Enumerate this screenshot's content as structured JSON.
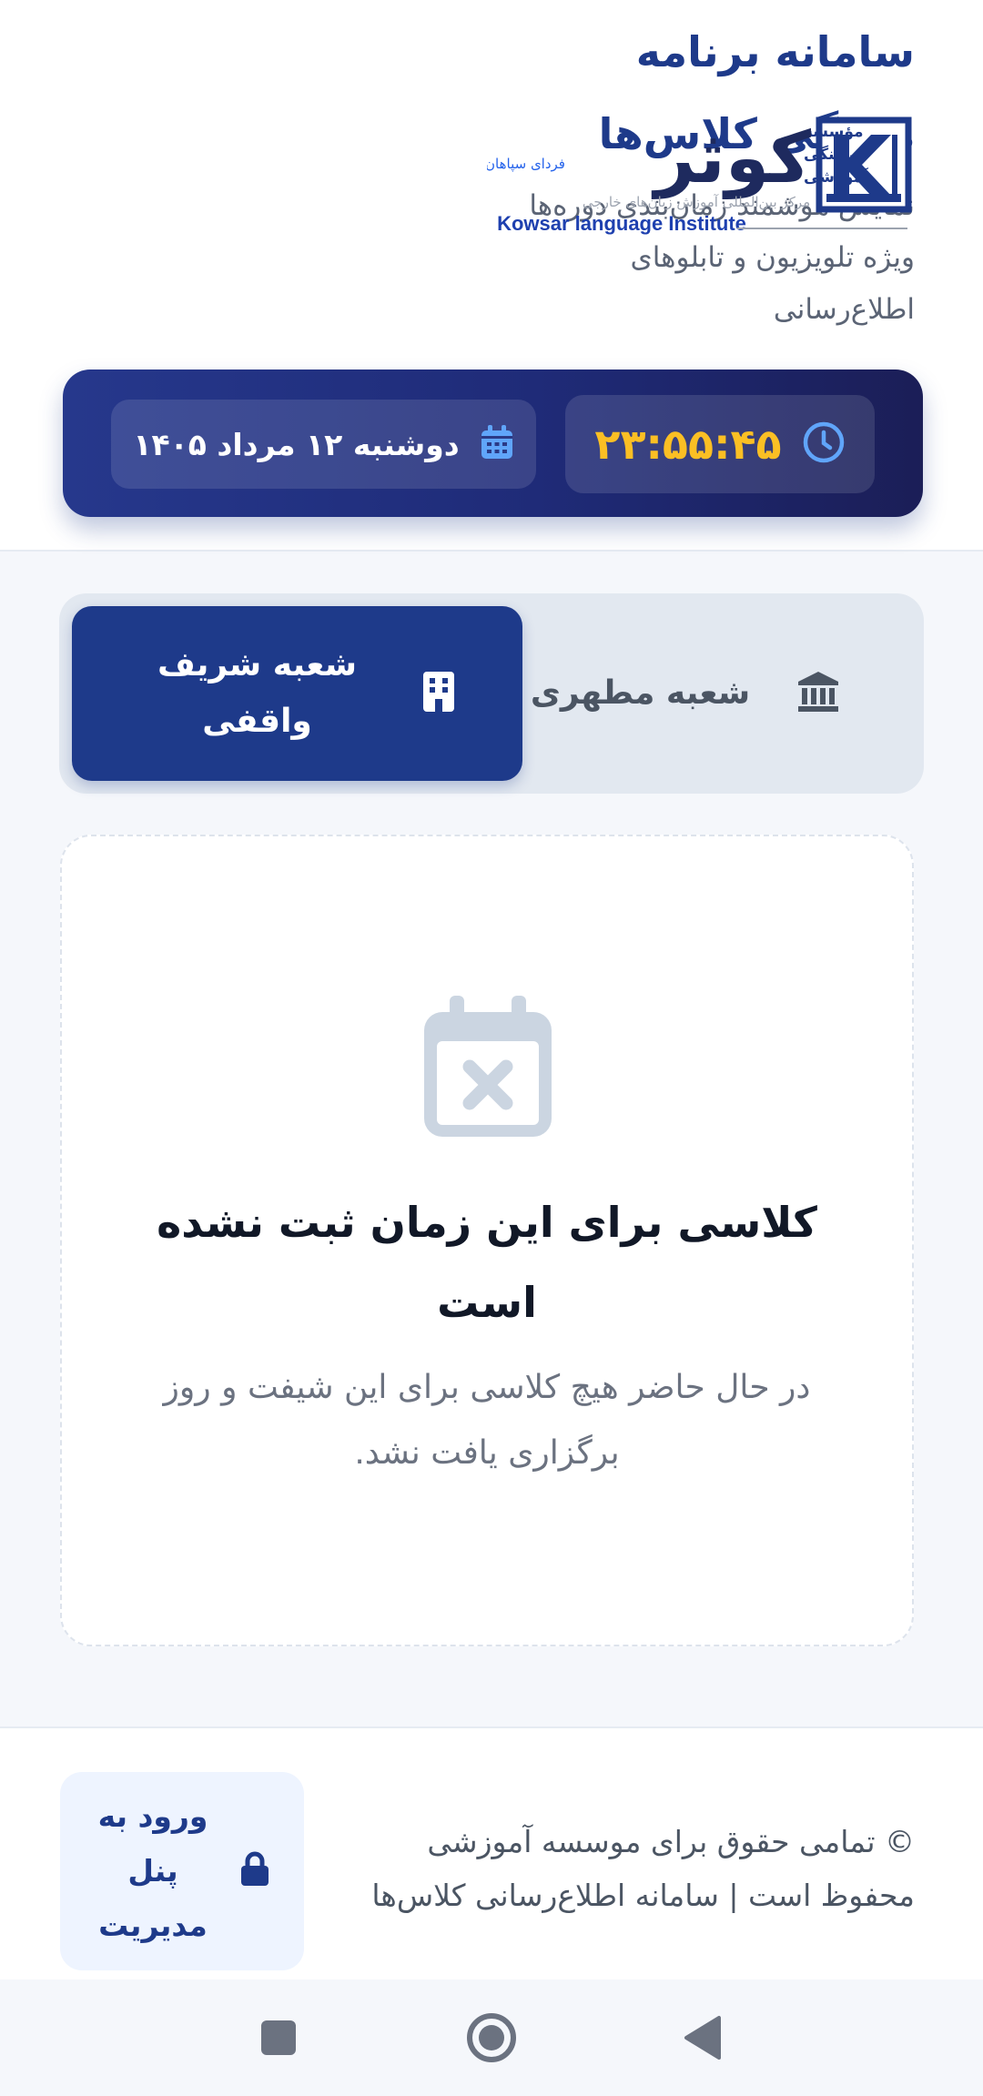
{
  "header": {
    "title": "سامانه برنامه هفتگی کلاس‌ها",
    "subtitle": "نمایش هوشمند زمان‌بندی دوره‌ها ویژه تلویزیون و تابلوهای اطلاع‌رسانی",
    "logo": {
      "name_fa": "کوثر",
      "tagline_fa": "فردای سپاهان",
      "org_lines": [
        "مؤسسه",
        "فرهنگی",
        "آموزشی"
      ],
      "center_fa": "مرکز بین‌المللی آموزش زبان‌های خارجی",
      "name_en": "Kowsar language Institute"
    }
  },
  "timebar": {
    "time": "۲۳:۵۵:۴۵",
    "date": "دوشنبه ۱۲ مرداد ۱۴۰۵",
    "clock_icon": "clock-icon",
    "calendar_icon": "calendar-icon"
  },
  "tabs": [
    {
      "label": "شعبه مطهری",
      "icon": "bank-icon",
      "active": false
    },
    {
      "label": "شعبه شریف واقفی",
      "icon": "building-icon",
      "active": true
    }
  ],
  "empty_state": {
    "icon": "calendar-x-icon",
    "title": "کلاسی برای این زمان ثبت نشده است",
    "description": "در حال حاضر هیچ کلاسی برای این شیفت و روز برگزاری یافت نشد."
  },
  "footer": {
    "copyright": "© تمامی حقوق برای موسسه آموزشی محفوظ است | سامانه اطلاع‌رسانی کلاس‌ها",
    "admin_button": "ورود به پنل مدیریت",
    "admin_icon": "lock-icon"
  },
  "colors": {
    "primary": "#1e3a8a",
    "clock": "#fbbf24",
    "muted": "#6b7280",
    "icon_muted": "#cbd5e1"
  }
}
